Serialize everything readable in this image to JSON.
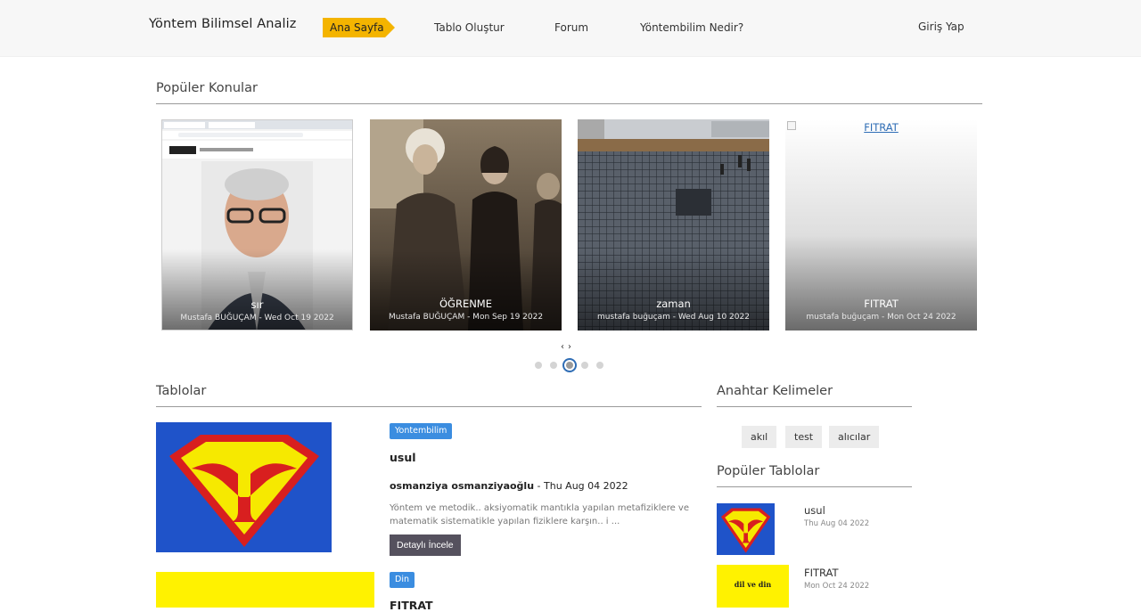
{
  "header": {
    "brand": "Yöntem Bilimsel Analiz",
    "nav": [
      {
        "label": "Ana Sayfa"
      },
      {
        "label": "Tablo Oluştur"
      },
      {
        "label": "Forum"
      },
      {
        "label": "Yöntembilim Nedir?"
      }
    ],
    "login": "Giriş Yap"
  },
  "popular_topics": {
    "title": "Popüler Konular",
    "cards": [
      {
        "title": "sır",
        "meta": "Mustafa BUĞUÇAM - Wed Oct 19 2022"
      },
      {
        "title": "ÖĞRENME",
        "meta": "Mustafa BUĞUÇAM - Mon Sep 19 2022"
      },
      {
        "title": "zaman",
        "meta": "mustafa buğuçam - Wed Aug 10 2022"
      },
      {
        "title": "FITRAT",
        "meta": "mustafa buğuçam - Mon Oct 24 2022",
        "broken_alt": "FITRAT"
      }
    ],
    "prev": "‹",
    "next": "›",
    "dots": 5,
    "active_dot": 3
  },
  "tables": {
    "title": "Tablolar",
    "posts": [
      {
        "badge": "Yontembilim",
        "title": "usul",
        "author": "osmanziya osmanziyaoğlu",
        "date": "Thu Aug 04 2022",
        "desc": "Yöntem ve metodik.. aksiyomatik mantıkla yapılan metafiziklere ve matematik sistematikle yapılan fiziklere karşın.. i ...",
        "button": "Detaylı İncele"
      },
      {
        "badge": "Din",
        "title": "FITRAT"
      }
    ]
  },
  "sidebar": {
    "keywords_title": "Anahtar Kelimeler",
    "keywords": [
      "akıl",
      "test",
      "alıcılar"
    ],
    "popular_tables_title": "Popüler Tablolar",
    "popular_tables": [
      {
        "title": "usul",
        "date": "Thu Aug 04 2022"
      },
      {
        "title": "FITRAT",
        "date": "Mon Oct 24 2022",
        "thumb_text": "dil ve din"
      }
    ]
  },
  "colors": {
    "accent": "#f4b400",
    "badge": "#3b8de0",
    "button": "#55515e"
  }
}
